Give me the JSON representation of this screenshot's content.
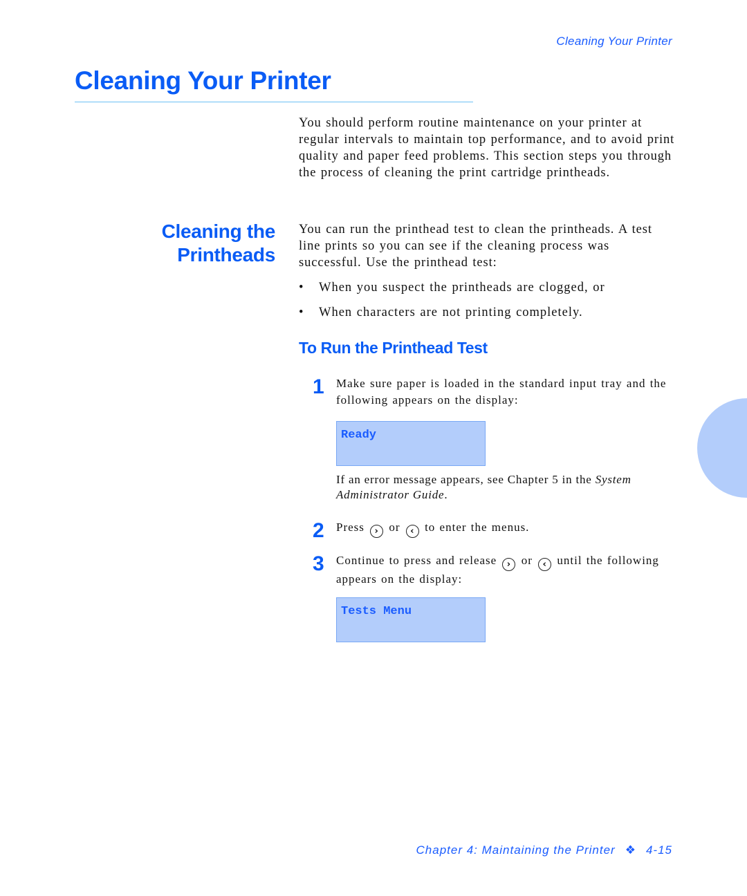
{
  "header": {
    "running_title": "Cleaning Your Printer"
  },
  "page_title": "Cleaning Your Printer",
  "intro": "You should perform routine maintenance on your printer at regular intervals to maintain top performance, and to avoid print quality and paper feed problems. This section steps you through the process of cleaning the print cartridge printheads.",
  "section": {
    "heading_line1": "Cleaning the",
    "heading_line2": "Printheads",
    "body": "You can run the printhead test to clean the printheads. A test line prints so you can see if the cleaning process was successful. Use the printhead test:",
    "bullets": [
      "When you suspect the printheads are clogged, or",
      "When characters are not printing completely."
    ]
  },
  "procedure": {
    "heading": "To Run the Printhead Test",
    "steps": [
      {
        "number": "1",
        "text": "Make sure paper is loaded in the standard input tray and the following appears on the display:",
        "display": "Ready"
      },
      {
        "number": "2",
        "text_before": "Press",
        "text_mid": "or",
        "text_after": "to enter the menus."
      },
      {
        "number": "3",
        "text_before": "Continue to press and release",
        "text_mid": "or",
        "text_after": "until the following appears on the display:",
        "display": "Tests Menu"
      }
    ],
    "note_prefix": "If an error message appears, see Chapter 5 in the",
    "note_italic": "System Administrator Guide",
    "note_suffix": "."
  },
  "icons": {
    "right": "›",
    "left": "‹",
    "bullet": "•",
    "separator": "❖"
  },
  "footer": {
    "chapter": "Chapter 4: Maintaining the Printer",
    "page": "4-15"
  },
  "colors": {
    "accent": "#0a5cf5",
    "lcd_bg": "#b3cdfb",
    "rule": "#6cc0f5"
  }
}
